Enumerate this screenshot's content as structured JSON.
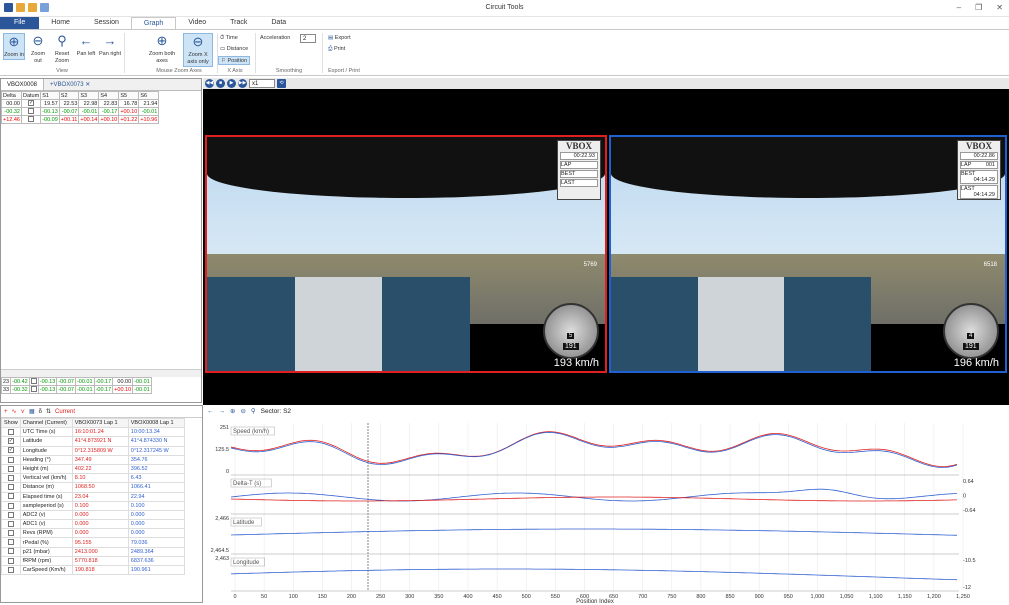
{
  "app": {
    "title": "Circuit Tools"
  },
  "menu": {
    "file": "File",
    "items": [
      "Home",
      "Session",
      "Graph",
      "Video",
      "Track",
      "Data"
    ],
    "active": "Graph"
  },
  "ribbon": {
    "zoom_in": "Zoom in",
    "zoom_out": "Zoom out",
    "reset_zoom": "Reset Zoom",
    "pan_left": "Pan left",
    "pan_right": "Pan right",
    "zoom_both": "Zoom both axes",
    "zoom_x": "Zoom X axis only",
    "time": "Time",
    "distance": "Distance",
    "position": "Position",
    "acceleration_label": "Acceleration",
    "acceleration_value": "2",
    "export": "Export",
    "print": "Print",
    "groups": {
      "view": "View",
      "mouse_zoom": "Mouse Zoom Axes",
      "x_axis": "X Axis",
      "smoothing": "Smoothing",
      "export_print": "Export / Print"
    }
  },
  "left_panel": {
    "tabs": [
      "VBOX0008",
      "+VBOX0073"
    ],
    "headers": [
      "Delta",
      "Datum",
      "S1",
      "S2",
      "S3",
      "S4",
      "S5",
      "S6"
    ],
    "rows": [
      {
        "delta": "00.00",
        "datum": true,
        "cells": [
          "19.57",
          "22.53",
          "22.98",
          "22.83",
          "16.78",
          "21.94"
        ]
      },
      {
        "delta": "-00.32",
        "datum": false,
        "cells": [
          "-00.13",
          "-00.07",
          "-00.01",
          "-00.17",
          "+00.10",
          "-00.01"
        ]
      },
      {
        "delta": "+12.46",
        "datum": false,
        "cells": [
          "-00.09",
          "+00.11",
          "+00.14",
          "+00.10",
          "+01.22",
          "+10.96"
        ]
      }
    ],
    "bottom_rows": [
      {
        "idx": "23",
        "delta": "-00.42",
        "cells": [
          "-00.13",
          "-00.07",
          "-00.01",
          "-00.17",
          "00.00",
          "-00.01"
        ]
      },
      {
        "idx": "33",
        "delta": "-00.32",
        "cells": [
          "-00.13",
          "-00.07",
          "-00.01",
          "-00.17",
          "+00.10",
          "-00.01"
        ]
      }
    ]
  },
  "video": {
    "speed_select": "x1",
    "left": {
      "brand": "VBOX",
      "time": "00:22.93",
      "lap_label": "LAP",
      "best_label": "BEST",
      "last_label": "LAST",
      "speed": "193 km/h",
      "gear": "5",
      "gauge_speed": "191",
      "rpm": "5769"
    },
    "right": {
      "brand": "VBOX",
      "time": "00:22.86",
      "lap_label": "LAP",
      "lap": "001",
      "best_label": "BEST",
      "best": "04:14.29",
      "last_label": "LAST",
      "last": "04:14.29",
      "speed": "196 km/h",
      "gear": "4",
      "gauge_speed": "191",
      "rpm": "6518"
    }
  },
  "channels": {
    "toolbar_label": "Current",
    "headers": [
      "Show",
      "Channel (Current)",
      "VBOX0073 Lap 1",
      "VBOX0008 Lap 1"
    ],
    "rows": [
      {
        "show": false,
        "name": "UTC Time (s)",
        "a": "16:10:01.24",
        "b": "10:00:13.34"
      },
      {
        "show": true,
        "name": "Latitude",
        "a": "41°4.873921 N",
        "b": "41°4.874330 N"
      },
      {
        "show": true,
        "name": "Longitude",
        "a": "0°12.315809 W",
        "b": "0°12.317245 W"
      },
      {
        "show": false,
        "name": "Heading (°)",
        "a": "347.49",
        "b": "354.76"
      },
      {
        "show": false,
        "name": "Height (m)",
        "a": "402.22",
        "b": "396.52"
      },
      {
        "show": false,
        "name": "Vertical vel (km/h)",
        "a": "8.10",
        "b": "6.43"
      },
      {
        "show": false,
        "name": "Distance (m)",
        "a": "1068.50",
        "b": "1066.41"
      },
      {
        "show": false,
        "name": "Elapsed time (s)",
        "a": "23.04",
        "b": "22.94"
      },
      {
        "show": false,
        "name": "sampleperiod (s)",
        "a": "0.100",
        "b": "0.100"
      },
      {
        "show": false,
        "name": "ADC2 (v)",
        "a": "0.000",
        "b": "0.000"
      },
      {
        "show": false,
        "name": "ADC1 (v)",
        "a": "0.000",
        "b": "0.000"
      },
      {
        "show": false,
        "name": "Revs (RPM)",
        "a": "0.000",
        "b": "0.000"
      },
      {
        "show": false,
        "name": "rPedal (%)",
        "a": "95.155",
        "b": "79.036"
      },
      {
        "show": false,
        "name": "p21 (mbar)",
        "a": "2413.000",
        "b": "2489.364"
      },
      {
        "show": false,
        "name": "fRPM (rpm)",
        "a": "5770.818",
        "b": "6837.636"
      },
      {
        "show": false,
        "name": "CarSpeed (Km/h)",
        "a": "190.818",
        "b": "190.961"
      }
    ]
  },
  "graph": {
    "sector": "Sector: S2",
    "xlabel": "Position Index",
    "xticks": [
      "0",
      "50",
      "100",
      "150",
      "200",
      "250",
      "300",
      "350",
      "400",
      "450",
      "500",
      "550",
      "600",
      "650",
      "700",
      "750",
      "800",
      "850",
      "900",
      "950",
      "1,000",
      "1,050",
      "1,100",
      "1,150",
      "1,200",
      "1,250"
    ],
    "panels": [
      {
        "label": "Speed (km/h)",
        "yticks_left": [
          "251",
          "125.5",
          "0"
        ],
        "yticks_right": []
      },
      {
        "label": "Delta-T (s)",
        "yticks_left": [],
        "yticks_right": [
          "0.64",
          "0",
          "-0.64"
        ]
      },
      {
        "label": "Latitude",
        "yticks_left": [
          "2,466",
          "2,464.5"
        ],
        "yticks_right": []
      },
      {
        "label": "Longitude",
        "yticks_left": [
          "2,463"
        ],
        "yticks_right": [
          "-10.5",
          "-12"
        ]
      }
    ],
    "colors": {
      "a": "#e02020",
      "b": "#3060d0"
    }
  }
}
